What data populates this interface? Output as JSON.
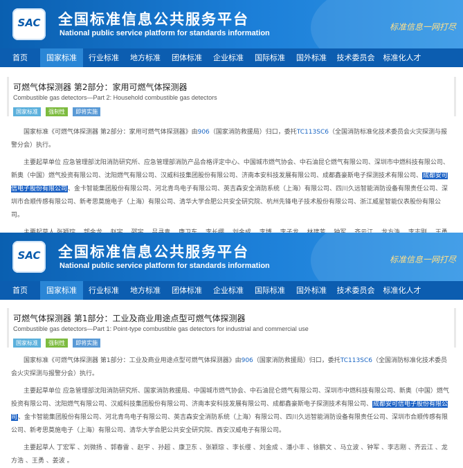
{
  "site": {
    "logo_text": "SAC",
    "title": "全国标准信息公共服务平台",
    "subtitle": "National public service platform  for standards information",
    "slogan": "标准信息一网打尽"
  },
  "nav": [
    "首页",
    "国家标准",
    "行业标准",
    "地方标准",
    "团体标准",
    "企业标准",
    "国际标准",
    "国外标准",
    "技术委员会",
    "标准化人才"
  ],
  "panels": [
    {
      "title": "可燃气体探测器 第2部分：家用可燃气体探测器",
      "title_en": "Combustible gas detectors—Part 2: Household combustible gas detectors",
      "badges": [
        "国家标准",
        "强制性",
        "即将实施"
      ],
      "intro_pre": "国家标准《可燃气体探测器 第2部分：家用可燃气体探测器》由",
      "code1": "906",
      "intro_mid": "（国家消防救援局）归口，委托",
      "code2": "TC113SC6",
      "intro_post": "（全国消防标准化技术委员会火灾探测与报警分会）执行。",
      "drafters_pre": "主要起草单位 应急管理部沈阳消防研究所、应急管理部消防产品合格评定中心、中国城市燃气协会、中石油昆仑燃气有限公司、深圳市中燃科技有限公司、新奥（中国）燃气投资有限公司、沈阳燃气有限公司、汉威科技集团股份有限公司、济南本安科技发展有限公司、成都鑫豪斯电子探测技术有限公司、",
      "highlight": "成都安可信电子股份有限公司",
      "drafters_post": "、金卡智能集团股份有限公司、河北青鸟电子有限公司、英吉森安全消防系统（上海）有限公司、四川久远智能消防设备有限责任公司、深圳市合顺传感有限公司、新考思莫施电子（上海）有限公司、清华大学合肥公共安全研究院、杭州先锋电子技术股份有限公司、浙江威星智能仪表股份有限公司。",
      "authors": "主要起草人 张颖琮 、郭金龙 、赵宇 、邵宇 、吕寻青 、康卫东 、李长缨 、刘金成 、李博 、李子龙 、林建芳 、钟军 、齐云江 、龙方浩 、李志刚 、王勇 、姜波 、马长城 、崔鲲 、赵彦平 。"
    },
    {
      "title": "可燃气体探测器 第1部分：工业及商业用途点型可燃气体探测器",
      "title_en": "Combustible gas detectors—Part 1: Point-type combustible gas detectors for industrial and commercial use",
      "badges": [
        "国家标准",
        "强制性",
        "即将实施"
      ],
      "intro_pre": "国家标准《可燃气体探测器 第1部分：工业及商业用途点型可燃气体探测器》由",
      "code1": "906",
      "intro_mid": "（国家消防救援局）归口，委托",
      "code2": "TC113SC6",
      "intro_post": "（全国消防标准化技术委员会火灾探测与报警分会）执行。",
      "drafters_pre": "主要起草单位 应急管理部沈阳消防研究所、国家消防救援局、中国城市燃气协会、中石油昆仑燃气有限公司、深圳市中燃科技有限公司、新奥（中国）燃气投资有限公司、沈阳燃气有限公司、汉威科技集团股份有限公司、济南本安科技发展有限公司、成都鑫豪斯电子探测技术有限公司、",
      "highlight": "成都安可信电子股份有限公司",
      "drafters_post": "、金卡智能集团股份有限公司、河北青鸟电子有限公司、英吉森安全消防系统（上海）有限公司、四川久远智能消防设备有限责任公司、深圳市合顺传感有限公司、新考思莫施电子（上海）有限公司、清华大学合肥公共安全研究院、西安汉威电子有限公司。",
      "authors": "主要起草人 丁宏军 、刘微扬 、郭春雷 、赵宇 、孙超 、康卫东 、张颖琮 、李长缨 、刘金成 、潘小丰 、徐鹏文 、马立波 、钟军 、李志刚 、齐云江 、龙方浩 、王勇 、姜波 。"
    }
  ]
}
